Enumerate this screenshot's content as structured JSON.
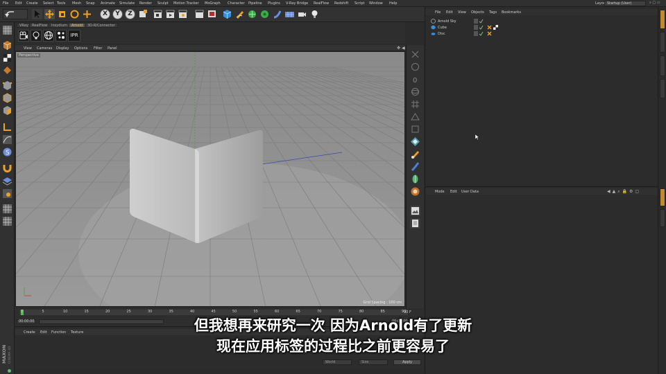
{
  "menubar": {
    "items": [
      "File",
      "Edit",
      "Create",
      "Select",
      "Tools",
      "Mesh",
      "Snap",
      "Animate",
      "Simulate",
      "Render",
      "Sculpt",
      "Motion Tracker",
      "MoGraph",
      "Character",
      "Pipeline",
      "Plugins",
      "V-Ray Bridge",
      "RealFlow",
      "Redshift",
      "Script",
      "Window",
      "Help"
    ],
    "layout_label": "Layout:",
    "layout_value": "Startup (User)"
  },
  "toolbar": {
    "axis_x": "X",
    "axis_y": "Y",
    "axis_z": "Z"
  },
  "render_tabs": [
    "VRay",
    "RealFlow",
    "Insydium",
    "Arnold",
    "3D-R/Connector"
  ],
  "arnold_bar": {
    "ipr_label": "IPR"
  },
  "viewport": {
    "menu": [
      "View",
      "Cameras",
      "Display",
      "Options",
      "Filter",
      "Panel"
    ],
    "perspective_label": "Perspective",
    "grid_spacing": "Grid Spacing : 100 cm",
    "background_color": "#8c8c8c"
  },
  "timeline": {
    "ticks": [
      "0",
      "5",
      "10",
      "15",
      "20",
      "25",
      "30",
      "35",
      "40",
      "45",
      "50",
      "55",
      "60",
      "65",
      "70",
      "75",
      "80",
      "85",
      "90"
    ],
    "frame_end": "90 F",
    "start_field": "00:00:00",
    "end_field": "00:00:00",
    "current_field": "00:00:00"
  },
  "material_manager": {
    "menu": [
      "Create",
      "Edit",
      "Function",
      "Texture"
    ]
  },
  "object_manager": {
    "menu": [
      "File",
      "Edit",
      "View",
      "Objects",
      "Tags",
      "Bookmarks"
    ],
    "objects": [
      {
        "name": "Arnold Sky",
        "icon": "sky-icon"
      },
      {
        "name": "Cube",
        "icon": "cube-icon"
      },
      {
        "name": "Disc",
        "icon": "disc-icon"
      }
    ]
  },
  "attribute_manager": {
    "menu": [
      "Mode",
      "Edit",
      "User Data"
    ]
  },
  "coord_row": {
    "mode_a": "World",
    "mode_b": "Size",
    "apply": "Apply"
  },
  "subtitle": {
    "line1": "但我想再来研究一次 因为Arnold有了更新",
    "line2": "现在应用标签的过程比之前更容易了"
  },
  "colors": {
    "accent": "#bf8b2e",
    "playhead": "#4ac24a"
  }
}
